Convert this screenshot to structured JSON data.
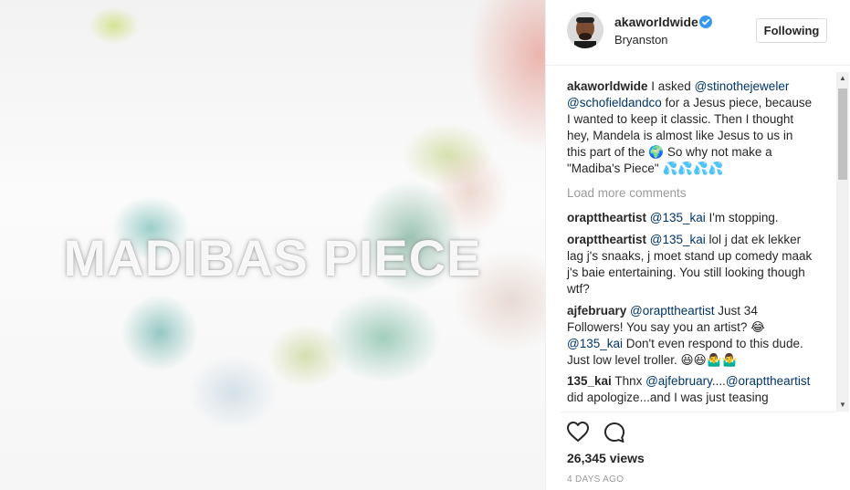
{
  "media": {
    "overlay_text": "MADIBAS PIECE"
  },
  "header": {
    "username": "akaworldwide",
    "location": "Bryanston",
    "follow_label": "Following"
  },
  "caption": {
    "username": "akaworldwide",
    "text_1": " I asked ",
    "mention_1": "@stinothejeweler",
    "mention_2": "@schofieldandco",
    "text_2": " for a Jesus piece, because I wanted to keep it classic. Then I thought hey, Mandela is almost like Jesus to us in this part of the ",
    "emoji_1": "🌍",
    "text_3": " So why not make a \"Madiba's Piece\" ",
    "emoji_2": "💦💦💦💦"
  },
  "load_more": "Load more comments",
  "comments": [
    {
      "username": "orapttheartist",
      "mention": "@135_kai",
      "text": " I'm stopping."
    },
    {
      "username": "orapttheartist",
      "mention": "@135_kai",
      "text": " lol j dat ek lekker lag j's snaaks, j moet stand up comedy maak j's baie entertaining. You still looking though wtf?"
    },
    {
      "username": "ajfebruary",
      "mention": "@orapttheartist",
      "text": " Just 34 Followers! You say you an artist? 😂 ",
      "mention_2": "@135_kai",
      "text_2": " Don't even respond to this dude. Just low level troller. 😆😆🤷‍♂️🤷‍♂️"
    },
    {
      "username": "135_kai",
      "text": " Thnx ",
      "mention": "@ajfebruary",
      "text_2": "....",
      "mention_2": "@orapttheartist",
      "text_3": " did apologize...and I was just teasing"
    }
  ],
  "actions": {
    "views": "26,345 views",
    "time": "4 DAYS AGO"
  },
  "icons": {
    "verified": "verified-badge-icon",
    "like": "heart-icon",
    "comment": "comment-bubble-icon"
  },
  "colors": {
    "mention": "#003569",
    "verified": "#3897f0",
    "muted": "#999999"
  }
}
